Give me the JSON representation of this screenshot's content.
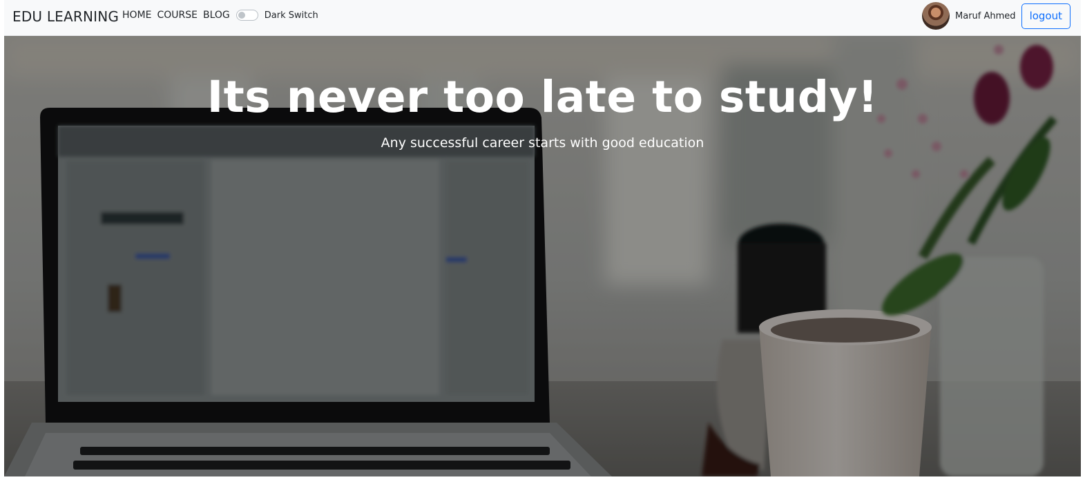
{
  "navbar": {
    "brand": "EDU LEARNING",
    "links": [
      "HOME",
      "COURSE",
      "BLOG"
    ],
    "dark_switch": {
      "label": "Dark Switch",
      "checked": false
    },
    "user": {
      "name": "Maruf Ahmed",
      "avatar_icon": "user-avatar"
    },
    "logout_label": "logout"
  },
  "hero": {
    "title": "Its never too late to study!",
    "subtitle": "Any successful career starts with good education",
    "background_image": "blurred laptop, coffee mug and flowers on a desk"
  },
  "colors": {
    "navbar_bg": "#f8f9fa",
    "primary": "#0d6efd",
    "text": "#212529",
    "hero_text": "#ffffff"
  }
}
